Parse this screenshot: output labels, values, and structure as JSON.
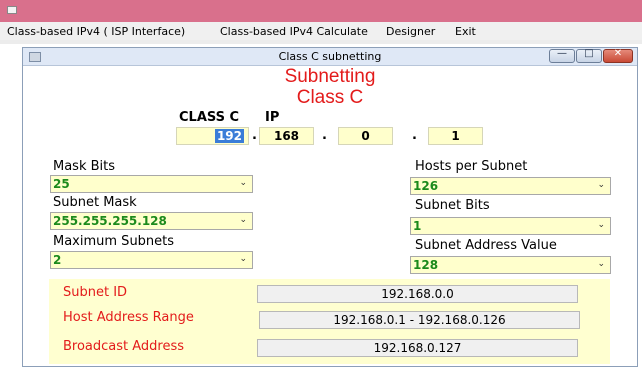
{
  "menu": {
    "items": [
      "Class-based IPv4 ( ISP Interface)",
      "Class-based IPv4 Calculate",
      "Designer",
      "Exit"
    ]
  },
  "window": {
    "title": "Class C subnetting",
    "minimize_glyph": "—",
    "maximize_glyph": "□",
    "close_glyph": "✕"
  },
  "heading": {
    "line1": "Subnetting",
    "line2": "Class C"
  },
  "ip": {
    "class_label": "CLASS C",
    "ip_label": "IP",
    "octets": [
      "192",
      "168",
      "0",
      "1"
    ],
    "separator": "."
  },
  "left": {
    "mask_bits_label": "Mask Bits",
    "mask_bits_value": "25",
    "subnet_mask_label": "Subnet Mask",
    "subnet_mask_value": "255.255.255.128",
    "max_subnets_label": "Maximum Subnets",
    "max_subnets_value": "2"
  },
  "right": {
    "hosts_label": "Hosts per Subnet",
    "hosts_value": "126",
    "subnet_bits_label": "Subnet Bits",
    "subnet_bits_value": "1",
    "subnet_addr_label": "Subnet Address Value",
    "subnet_addr_value": "128"
  },
  "results": {
    "subnet_id_label": "Subnet ID",
    "subnet_id_value": "192.168.0.0",
    "host_range_label": "Host Address Range",
    "host_range_value": "192.168.0.1 - 192.168.0.126",
    "broadcast_label": "Broadcast Address",
    "broadcast_value": "192.168.0.127"
  },
  "icons": {
    "dropdown": "chevron-down-icon"
  },
  "colors": {
    "heading": "#e31b1b",
    "value_green": "#1c8a1c",
    "input_bg": "#ffffcc",
    "outer_titlebar": "#d9708c"
  }
}
